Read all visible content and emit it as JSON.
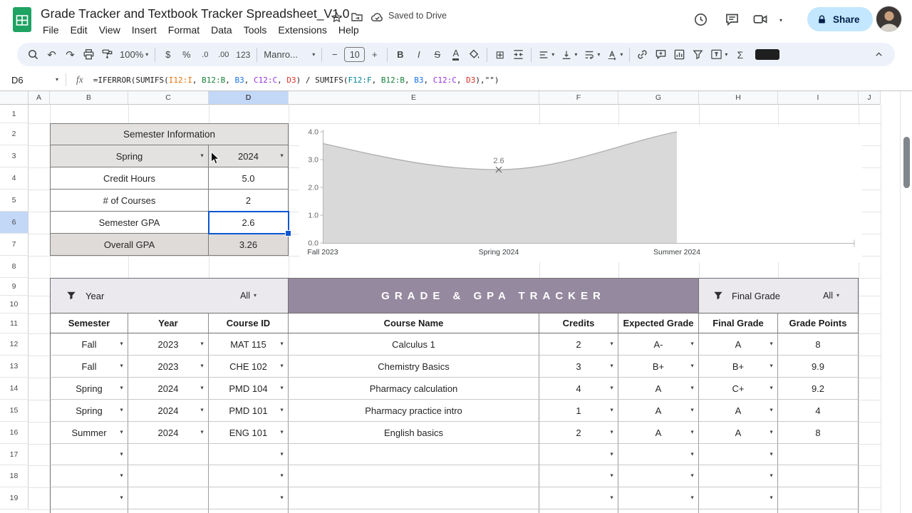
{
  "topbar": {
    "title": "Grade Tracker and Textbook Tracker Spreadsheet_V1.0",
    "saved_status": "Saved to Drive",
    "share_label": "Share",
    "menus": [
      "File",
      "Edit",
      "View",
      "Insert",
      "Format",
      "Data",
      "Tools",
      "Extensions",
      "Help"
    ]
  },
  "icons": {
    "caret": "▾",
    "cell_dropdown": "▼",
    "undo": "↶",
    "redo": "↷",
    "borders": "⊞",
    "sigma": "Σ",
    "minus": "−",
    "plus": "+"
  },
  "toolbar": {
    "zoom_value": "100%",
    "currency": "$",
    "percent": "%",
    "decimal_decrease": ".0",
    "decimal_increase": ".00",
    "number_format": "123",
    "font_name": "Manro...",
    "font_size": "10",
    "bold": "B",
    "italic": "I",
    "strikethrough": "S",
    "text_color": "A"
  },
  "formula_bar": {
    "cell_ref": "D6",
    "fx_label": "fx",
    "segments": [
      {
        "text": "=IFERROR(SUMIFS(",
        "color": "#222222"
      },
      {
        "text": "I12:I",
        "color": "#e8710a"
      },
      {
        "text": ", ",
        "color": "#222222"
      },
      {
        "text": "B12:B",
        "color": "#188038"
      },
      {
        "text": ", ",
        "color": "#222222"
      },
      {
        "text": "B3",
        "color": "#1a73e8"
      },
      {
        "text": ", ",
        "color": "#222222"
      },
      {
        "text": "C12:C",
        "color": "#9334e6"
      },
      {
        "text": ", ",
        "color": "#222222"
      },
      {
        "text": "D3",
        "color": "#d93025"
      },
      {
        "text": ") / SUMIFS(",
        "color": "#222222"
      },
      {
        "text": "F12:F",
        "color": "#00838f"
      },
      {
        "text": ", ",
        "color": "#222222"
      },
      {
        "text": "B12:B",
        "color": "#188038"
      },
      {
        "text": ", ",
        "color": "#222222"
      },
      {
        "text": "B3",
        "color": "#1a73e8"
      },
      {
        "text": ", ",
        "color": "#222222"
      },
      {
        "text": "C12:C",
        "color": "#9334e6"
      },
      {
        "text": ", ",
        "color": "#222222"
      },
      {
        "text": "D3",
        "color": "#d93025"
      },
      {
        "text": "),\"\")",
        "color": "#222222"
      }
    ]
  },
  "grid": {
    "col_headers": [
      "A",
      "B",
      "C",
      "D",
      "E",
      "F",
      "G",
      "H",
      "I",
      "J"
    ],
    "selected_col": "D",
    "row_headers": [
      "1",
      "2",
      "3",
      "4",
      "5",
      "6",
      "7",
      "8",
      "9",
      "10",
      "11",
      "12",
      "13",
      "14",
      "15",
      "16",
      "17",
      "18",
      "19"
    ],
    "selected_row": "6"
  },
  "semester_info": {
    "title": "Semester Information",
    "semester_value": "Spring",
    "year_value": "2024",
    "rows": [
      {
        "label": "Credit Hours",
        "value": "5.0"
      },
      {
        "label": "# of Courses",
        "value": "2"
      },
      {
        "label": "Semester GPA",
        "value": "2.6"
      },
      {
        "label": "Overall GPA",
        "value": "3.26"
      }
    ]
  },
  "chart_data": {
    "type": "area",
    "categories": [
      "Fall 2023",
      "Spring 2024",
      "Summer 2024"
    ],
    "values": [
      3.58,
      2.64,
      4.0
    ],
    "point_label": {
      "category": "Spring 2024",
      "text": "2.6"
    },
    "ylim": [
      0.0,
      4.0
    ],
    "yticks": [
      "4.0",
      "3.0",
      "2.0",
      "1.0",
      "0.0"
    ],
    "series_color": "#d9d9d9",
    "legend": "none",
    "grid": false
  },
  "tracker": {
    "title": "GRADE & GPA TRACKER",
    "left_filter": {
      "label": "Year",
      "value": "All"
    },
    "right_filter": {
      "label": "Final Grade",
      "value": "All"
    },
    "columns": [
      "Semester",
      "Year",
      "Course ID",
      "Course Name",
      "Credits",
      "Expected Grade",
      "Final Grade",
      "Grade Points"
    ],
    "rows": [
      [
        "Fall",
        "2023",
        "MAT 115",
        "Calculus 1",
        "2",
        "A-",
        "A",
        "8"
      ],
      [
        "Fall",
        "2023",
        "CHE 102",
        "Chemistry Basics",
        "3",
        "B+",
        "B+",
        "9.9"
      ],
      [
        "Spring",
        "2024",
        "PMD 104",
        "Pharmacy calculation",
        "4",
        "A",
        "C+",
        "9.2"
      ],
      [
        "Spring",
        "2024",
        "PMD 101",
        "Pharmacy practice intro",
        "1",
        "A",
        "A",
        "4"
      ],
      [
        "Summer",
        "2024",
        "ENG 101",
        "English basics",
        "2",
        "A",
        "A",
        "8"
      ]
    ],
    "empty_row_count": 3
  }
}
